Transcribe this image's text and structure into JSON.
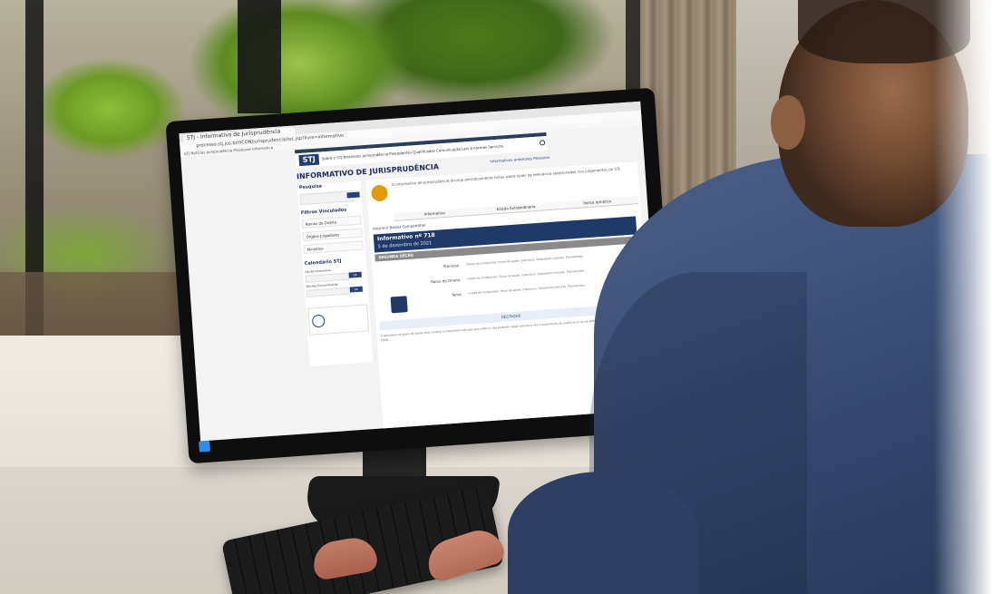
{
  "browser": {
    "tab_title": "STJ - Informativo de Jurisprudência",
    "url": "processo.stj.jus.br/SCON/jurisprudencia/toc.jsp?livre=informativo",
    "bookmarks": "STJ   Notícias   Jurisprudência   Processos   Informativo"
  },
  "site": {
    "logo": "STJ",
    "nav": "Sobre o STJ   Processos   Jurisprudência   Precedentes Qualificados   Comunicação   Leis e normas   Serviços",
    "page_title": "INFORMATIVO DE JURISPRUDÊNCIA",
    "top_links": "Informativos anteriores   Pesquisa"
  },
  "sidebar": {
    "search_title": "Pesquisa",
    "filter_title": "Filtros Vinculados",
    "items": [
      "Ramos do Direito",
      "Órgãos Julgadores",
      "Ministros"
    ],
    "calendar_title": "Calendário STJ",
    "date_label_1": "Edição Informativa",
    "date_label_2": "Edições Extraordinárias",
    "button": "OK"
  },
  "main": {
    "notice": "O Informativo de Jurisprudência divulga periodicamente notas sobre teses de relevância selecionadas nos julgamentos do STJ.",
    "tabs": [
      "Informativo",
      "Edição Extraordinária",
      "Índice temático"
    ],
    "actions": "Imprimir   Baixar   Compartilhar",
    "edition_title": "Informativo nº 718",
    "edition_date": "5 de dezembro de 2021",
    "section": "SEGUNDA SEÇÃO",
    "row_labels": [
      "Processo",
      "Ramo do Direito",
      "Tema"
    ],
    "row_text": "Direito do Consumidor. Plano de saúde. Cobertura. Tratamento indicado. Precedentes.",
    "destaque": "DESTAQUE",
    "body": "A operadora de plano de saúde deve custear o tratamento indicado pelo médico, não podendo negar cobertura sob o fundamento de ausência no rol da ANS. INFORMAÇÕES DO INTEIRO TEOR..."
  }
}
